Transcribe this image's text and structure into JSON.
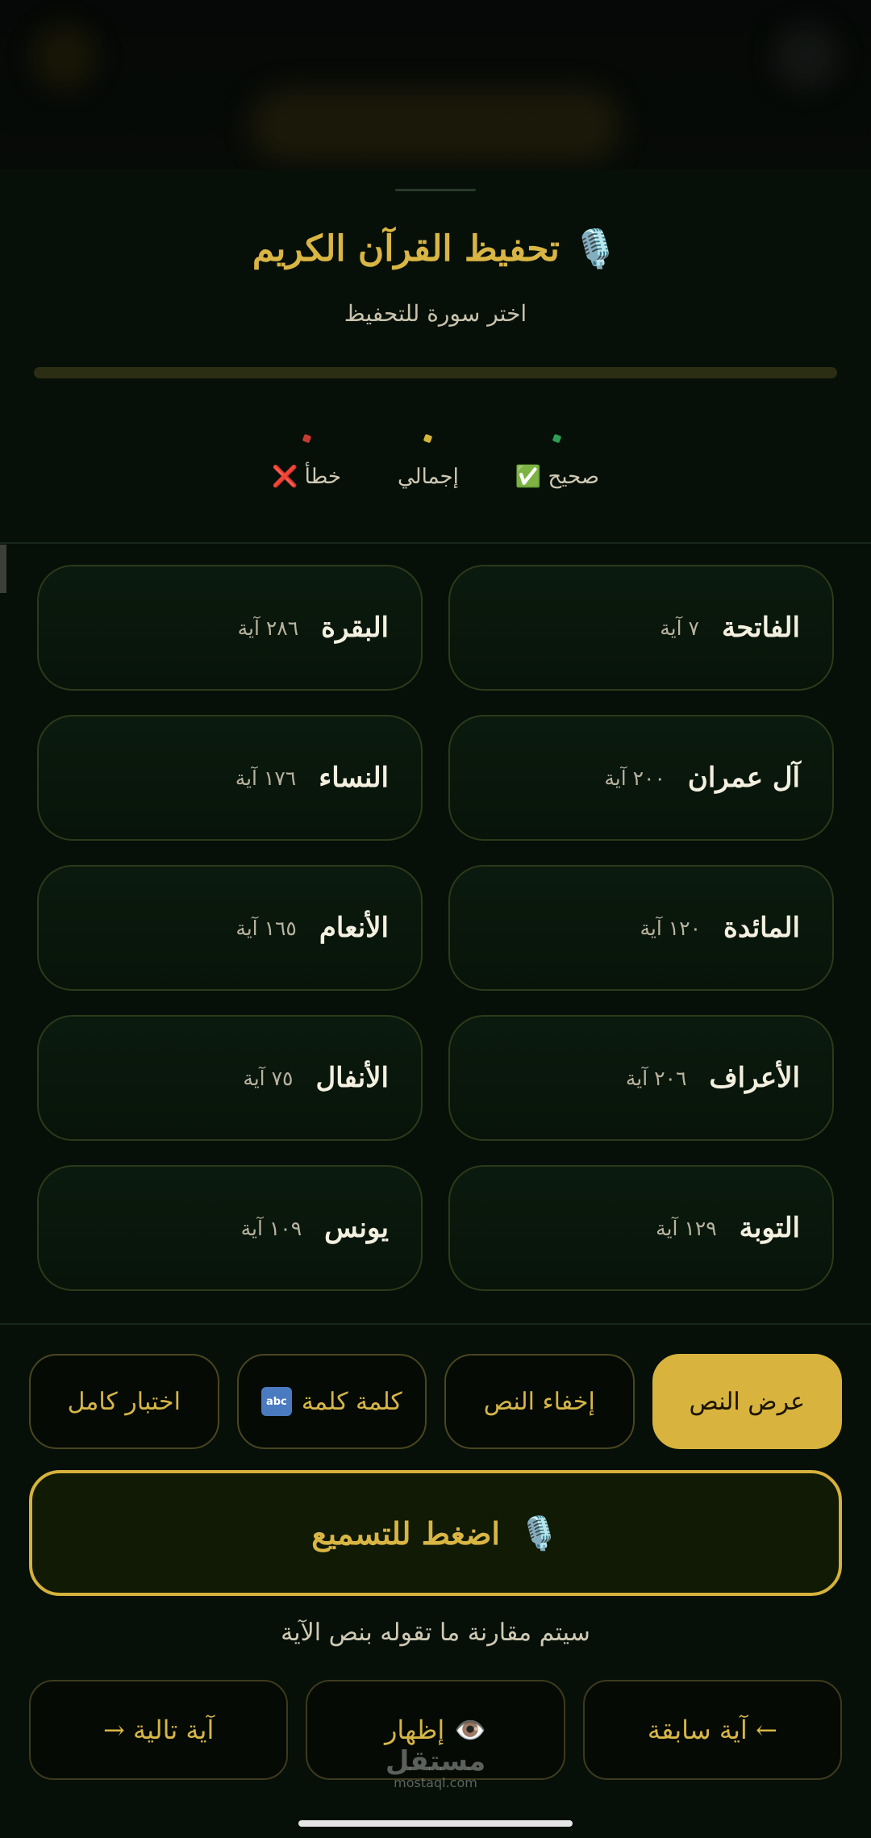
{
  "header": {
    "title": "تحفيظ القرآن الكريم",
    "mic_icon": "🎙️",
    "subtitle": "اختر سورة للتحفيظ"
  },
  "progress": {
    "fraction": 0
  },
  "stats": [
    {
      "label": "صحيح ✅",
      "color": "#2e9e55"
    },
    {
      "label": "إجمالي",
      "color": "#d4b53a"
    },
    {
      "label": "خطأ ❌",
      "color": "#c83a2e"
    }
  ],
  "surahs": [
    {
      "name": "الفاتحة",
      "count": "٧ آية"
    },
    {
      "name": "البقرة",
      "count": "٢٨٦ آية"
    },
    {
      "name": "آل عمران",
      "count": "٢٠٠ آية"
    },
    {
      "name": "النساء",
      "count": "١٧٦ آية"
    },
    {
      "name": "المائدة",
      "count": "١٢٠ آية"
    },
    {
      "name": "الأنعام",
      "count": "١٦٥ آية"
    },
    {
      "name": "الأعراف",
      "count": "٢٠٦ آية"
    },
    {
      "name": "الأنفال",
      "count": "٧٥ آية"
    },
    {
      "name": "التوبة",
      "count": "١٢٩ آية"
    },
    {
      "name": "يونس",
      "count": "١٠٩ آية"
    }
  ],
  "modes": {
    "show_text": "عرض النص",
    "hide_text": "إخفاء النص",
    "word_by_word": "كلمة كلمة",
    "word_icon": "abc",
    "full_test": "اختبار كامل"
  },
  "recite": {
    "label": "اضغط للتسميع",
    "icon": "🎙️",
    "hint": "سيتم مقارنة ما تقوله بنص الآية"
  },
  "nav": {
    "prev": "← آية سابقة",
    "show": "إظهار",
    "show_icon": "👁️",
    "next": "آية تالية →"
  },
  "watermark": {
    "ar": "مستقل",
    "en": "mostaql.com"
  },
  "colors": {
    "accent": "#d8b43e",
    "background": "#061008"
  }
}
